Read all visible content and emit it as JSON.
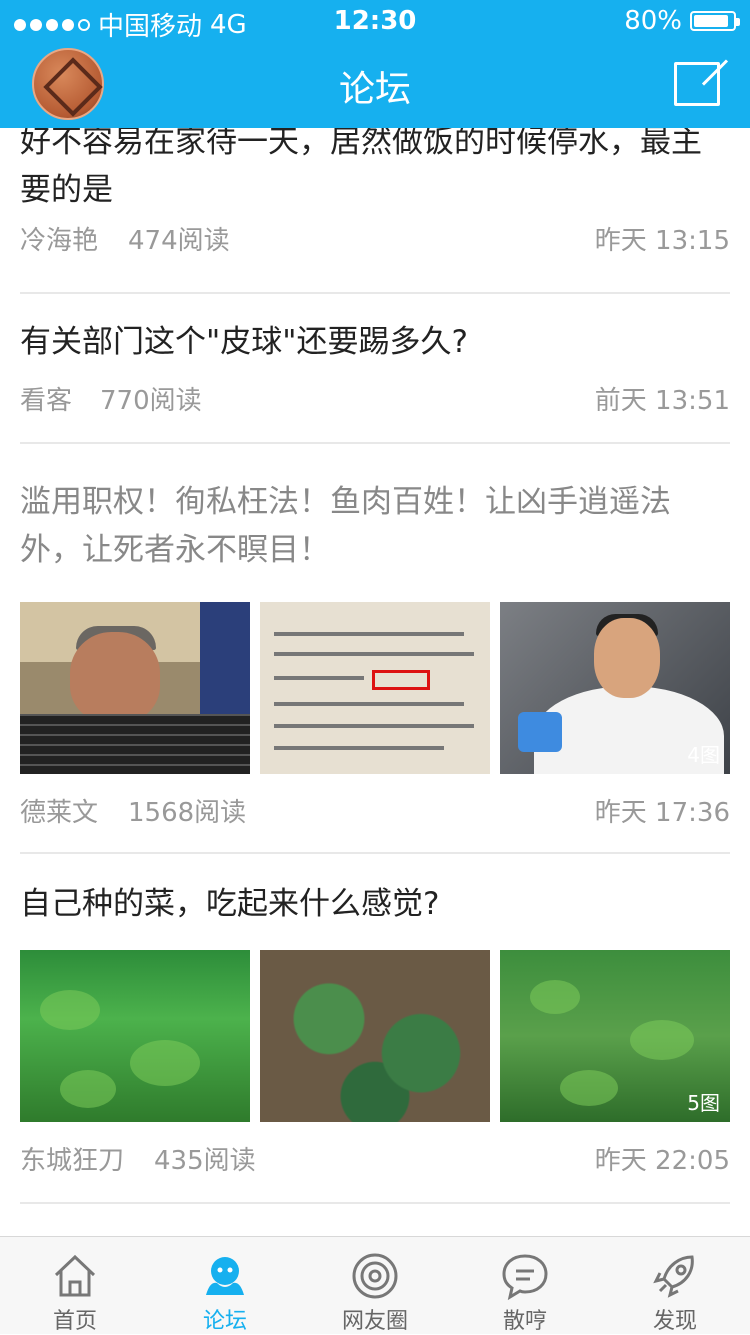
{
  "status_bar": {
    "carrier": "中国移动",
    "network": "4G",
    "time": "12:30",
    "battery": "80%"
  },
  "nav": {
    "title": "论坛"
  },
  "posts": [
    {
      "title": "好不容易在家待一天，居然做饭的时候停水，最主要的是",
      "author": "冷海艳",
      "reads": "474阅读",
      "time": "昨天 13:15"
    },
    {
      "title": "有关部门这个\"皮球\"还要踢多久?",
      "author": "看客",
      "reads": "770阅读",
      "time": "前天 13:51"
    },
    {
      "title": "滥用职权！徇私枉法！鱼肉百姓！让凶手逍遥法外，让死者永不瞑目！",
      "author": "德莱文",
      "reads": "1568阅读",
      "time": "昨天 17:36",
      "image_count": "4图"
    },
    {
      "title": "自己种的菜，吃起来什么感觉?",
      "author": "东城狂刀",
      "reads": "435阅读",
      "time": "昨天 22:05",
      "image_count": "5图"
    }
  ],
  "tabs": [
    {
      "label": "首页",
      "icon": "home-icon"
    },
    {
      "label": "论坛",
      "icon": "forum-icon"
    },
    {
      "label": "网友圈",
      "icon": "circle-icon"
    },
    {
      "label": "散哼",
      "icon": "chat-icon"
    },
    {
      "label": "发现",
      "icon": "rocket-icon"
    }
  ],
  "colors": {
    "primary": "#16b0ef"
  }
}
